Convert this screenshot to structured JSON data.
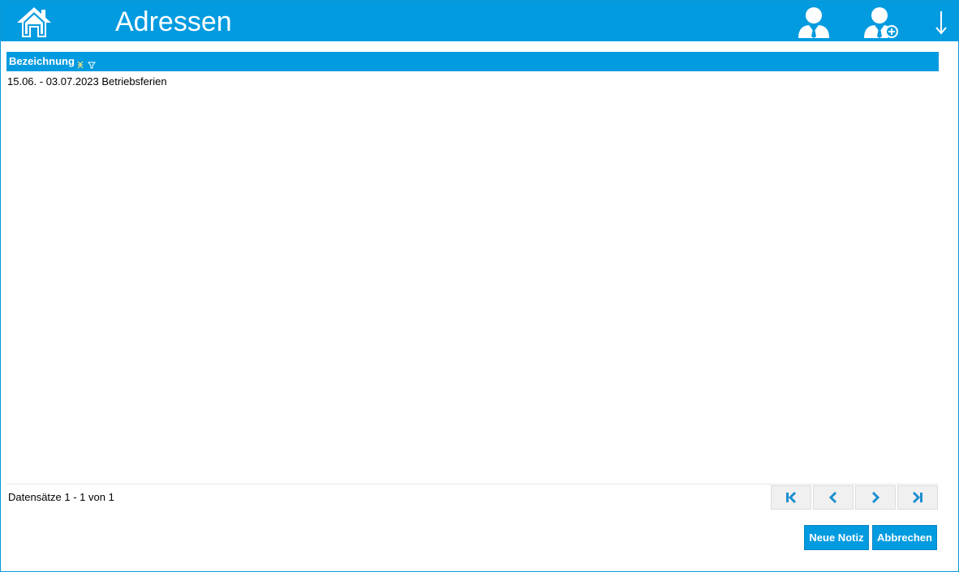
{
  "header": {
    "title": "Adressen",
    "home_icon": "home-icon",
    "person_icon": "person-icon",
    "add_person_icon": "person-add-icon",
    "download_icon": "arrow-down-icon"
  },
  "grid": {
    "columns": [
      {
        "label": "Bezeichnung",
        "icons": [
          "sort-icon",
          "filter-icon"
        ]
      }
    ],
    "rows": [
      {
        "bezeichnung": "15.06. - 03.07.2023 Betriebsferien"
      }
    ]
  },
  "footer": {
    "record_info": "Datensätze 1 - 1 von 1",
    "pager": [
      "first-page-icon",
      "previous-page-icon",
      "next-page-icon",
      "last-page-icon"
    ],
    "buttons": {
      "new_note": "Neue Notiz",
      "cancel": "Abbrechen"
    }
  },
  "colors": {
    "accent": "#039be0",
    "pager_icon": "#1a8fcf",
    "header_icon_yellow": "#f7e27a"
  }
}
